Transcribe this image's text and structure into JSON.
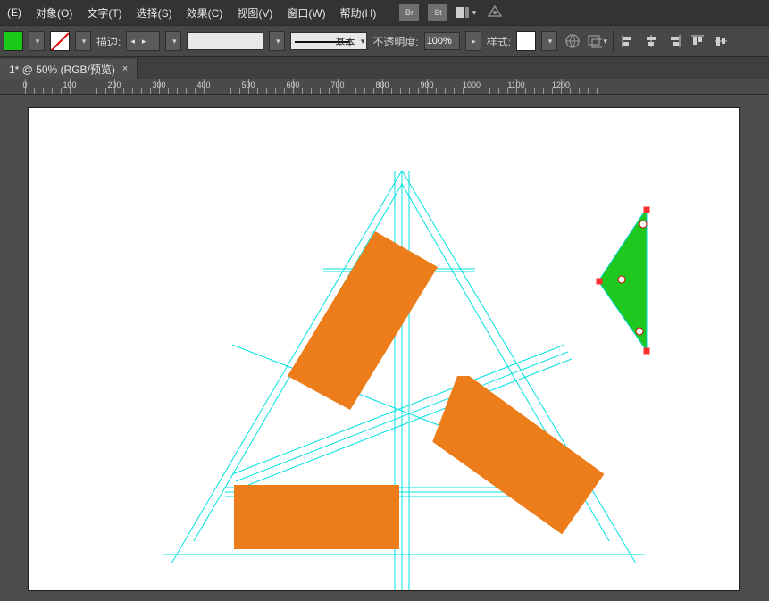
{
  "menubar": {
    "items": [
      "(E)",
      "对象(O)",
      "文字(T)",
      "选择(S)",
      "效果(C)",
      "视图(V)",
      "窗口(W)",
      "帮助(H)"
    ],
    "icons": [
      "Br",
      "St"
    ]
  },
  "toolbar": {
    "stroke_label": "描边:",
    "stroke_val": "",
    "weight_label": "基本",
    "opacity_label": "不透明度:",
    "opacity_val": "100%",
    "style_label": "样式:"
  },
  "tab": {
    "title": "1* @ 50% (RGB/预览)"
  },
  "ruler": {
    "marks": [
      "0",
      "100",
      "200",
      "300",
      "400",
      "500",
      "600",
      "700",
      "800",
      "900",
      "1000",
      "1100",
      "1200"
    ]
  },
  "chart_data": {
    "type": "vector_artwork",
    "description": "Illustrator canvas with three orange rectangles forming a rotational triangular logo, cyan construction guides, and a separate selected green triangle sliver on the right with red selection handles.",
    "orange_shapes": 3,
    "green_shapes_selected": 1,
    "guide_color": "#00e0e0",
    "orange": "#ed7d1a",
    "green": "#1ec81e"
  }
}
